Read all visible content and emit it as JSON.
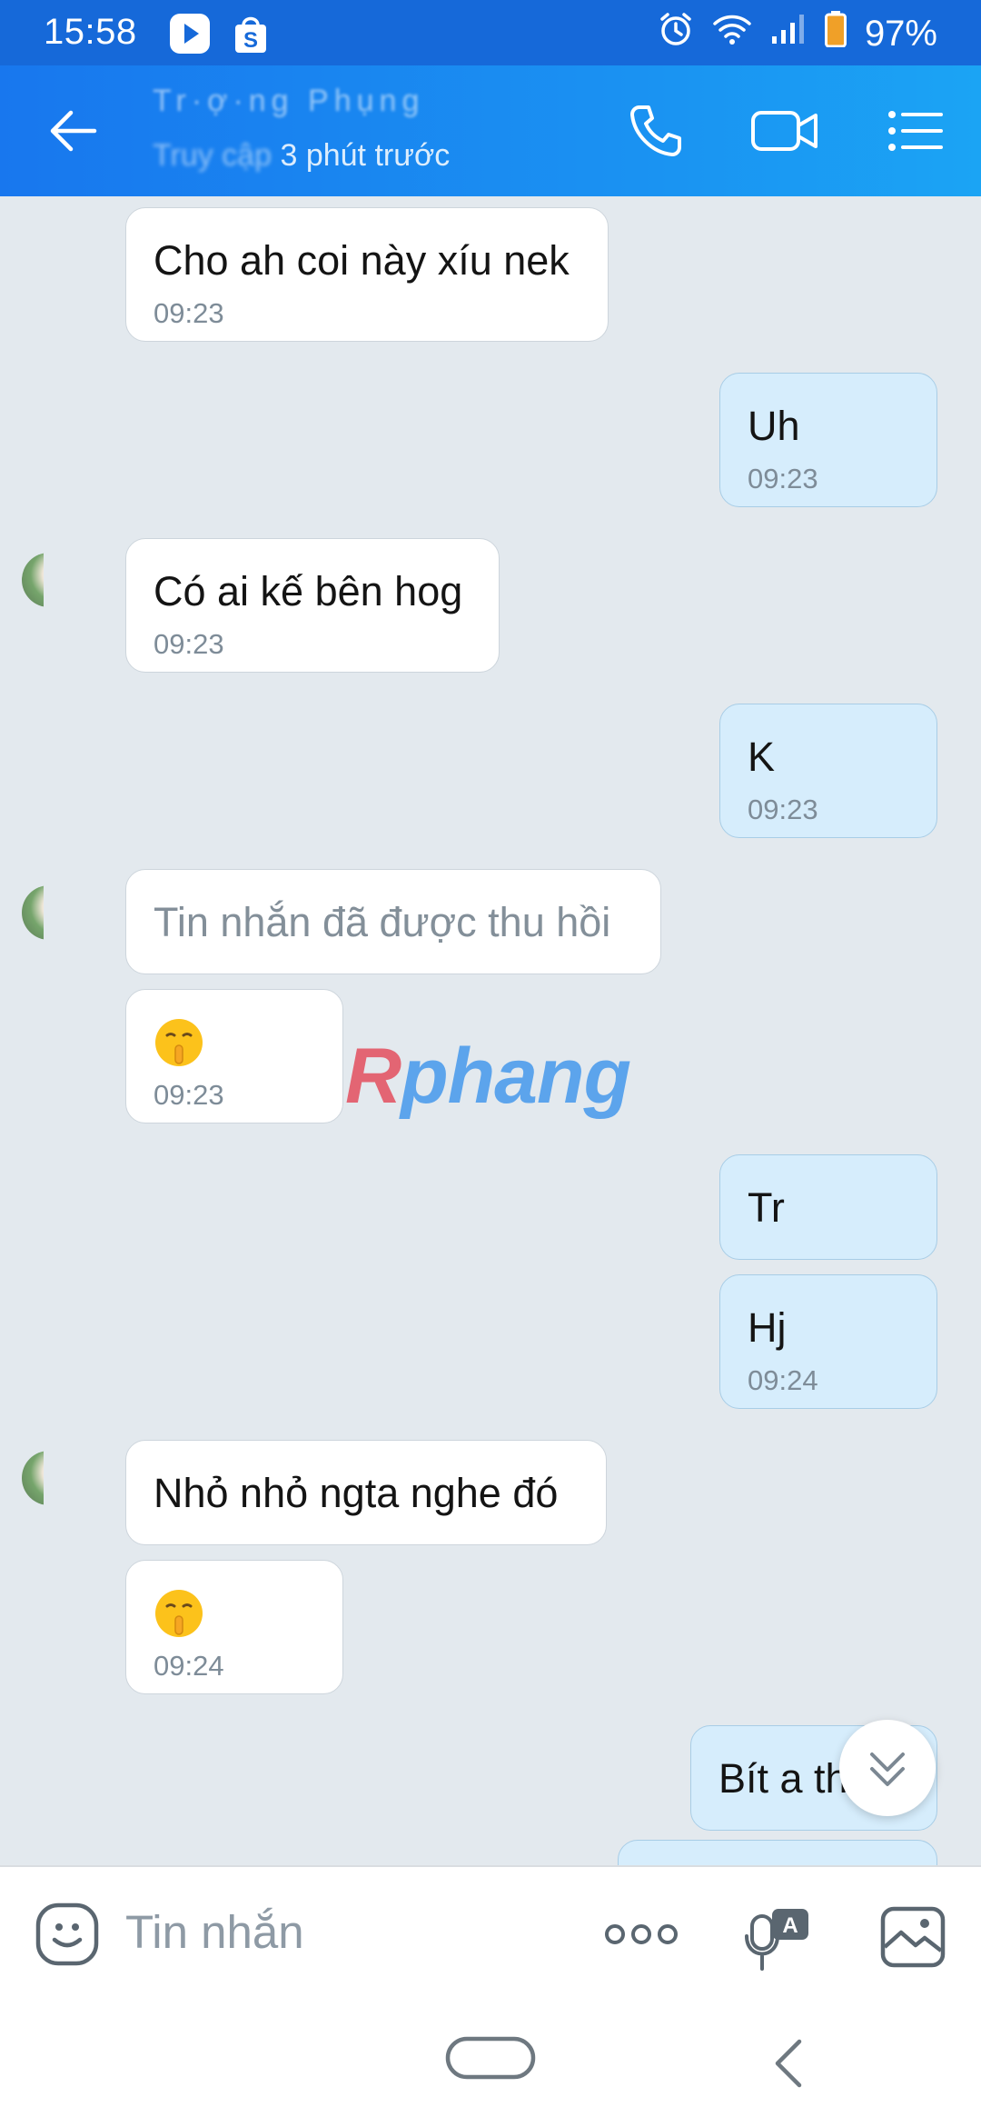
{
  "status_bar": {
    "time": "15:58",
    "battery": "97%",
    "icons": [
      "play-app-icon",
      "shopping-bag-icon",
      "alarm-icon",
      "wifi-icon",
      "signal-icon",
      "battery-icon"
    ]
  },
  "header": {
    "contact_name": "Tr·ợ·ng Phụng",
    "last_seen": "3 phút trước",
    "last_seen_prefix": "Truy cập",
    "icons": [
      "back-arrow-icon",
      "phone-icon",
      "video-call-icon",
      "menu-list-icon"
    ]
  },
  "messages": [
    {
      "dir": "in",
      "text": "Cho ah coi này xíu nek",
      "time": "09:23"
    },
    {
      "dir": "out",
      "text": "Uh",
      "time": "09:23"
    },
    {
      "dir": "in",
      "text": "Có ai kế bên hog",
      "time": "09:23"
    },
    {
      "dir": "out",
      "text": "K",
      "time": "09:23"
    },
    {
      "dir": "in",
      "text": "Tin nhắn đã được thu hồi",
      "time": ""
    },
    {
      "dir": "in",
      "emoji": "shushing-face",
      "time": "09:23"
    },
    {
      "dir": "out",
      "text": "Tr",
      "time": ""
    },
    {
      "dir": "out",
      "text": "Hj",
      "time": "09:24"
    },
    {
      "dir": "in",
      "text": "Nhỏ nhỏ ngta nghe đó",
      "time": ""
    },
    {
      "dir": "in",
      "emoji": "shushing-face",
      "time": "09:24"
    },
    {
      "dir": "out",
      "text": "Bít a th",
      "time": ""
    }
  ],
  "watermark": {
    "first": "R",
    "rest": "phang"
  },
  "composer": {
    "placeholder": "Tin nhắn",
    "icons": [
      "sticker-face-icon",
      "more-dots-icon",
      "voice-to-text-icon",
      "image-gallery-icon"
    ]
  },
  "colors": {
    "header_blue": "#1a86f0",
    "chat_background": "#e3e9ee",
    "incoming_bubble": "#ffffff",
    "outgoing_bubble": "#d6edfc",
    "timestamp": "#7e8c98"
  }
}
